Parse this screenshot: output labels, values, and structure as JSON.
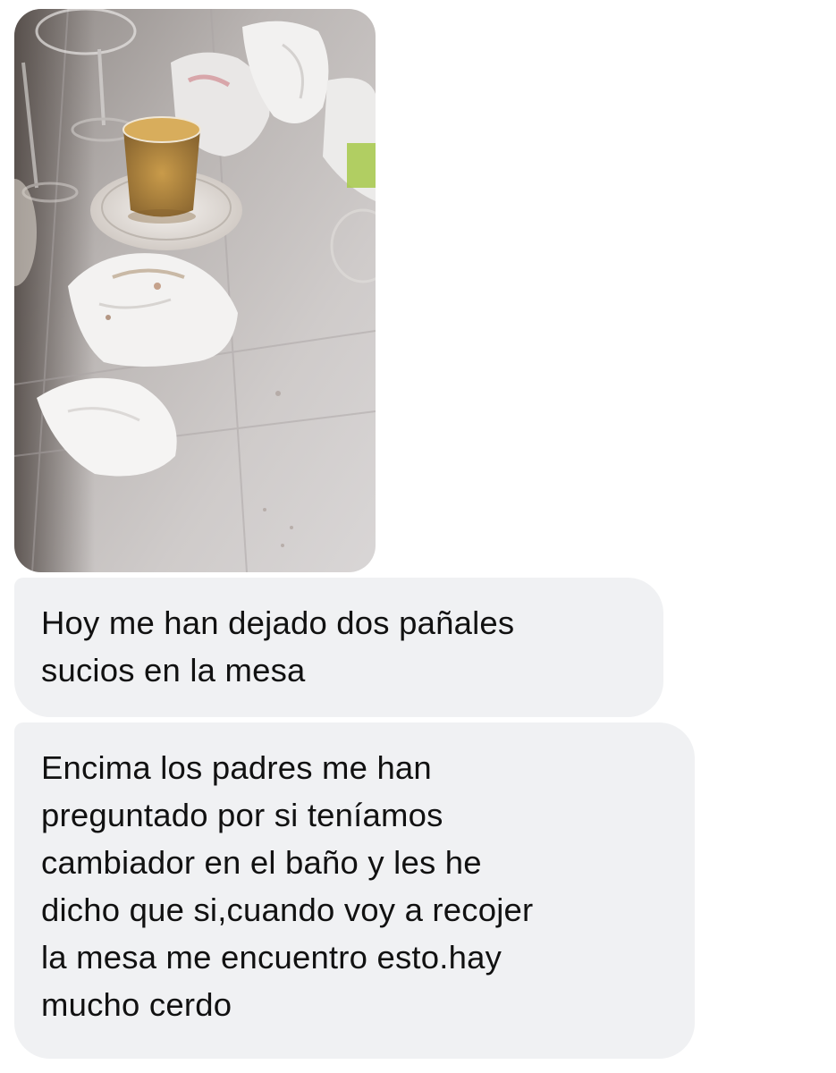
{
  "conversation": {
    "attachment": {
      "type": "photo",
      "subject": "table-with-napkins-and-drink-photo"
    },
    "messages": [
      {
        "text": "Hoy me han dejado dos pañales\nsucios en la mesa"
      },
      {
        "text": "Encima los padres me han\npreguntado por si teníamos\ncambiador en el baño y les he\ndicho que si,cuando voy a recojer\nla mesa me encuentro esto.hay\nmucho cerdo"
      }
    ]
  },
  "colors": {
    "page_background": "#ffffff",
    "bubble_background": "#f0f1f3",
    "text": "#111111"
  }
}
